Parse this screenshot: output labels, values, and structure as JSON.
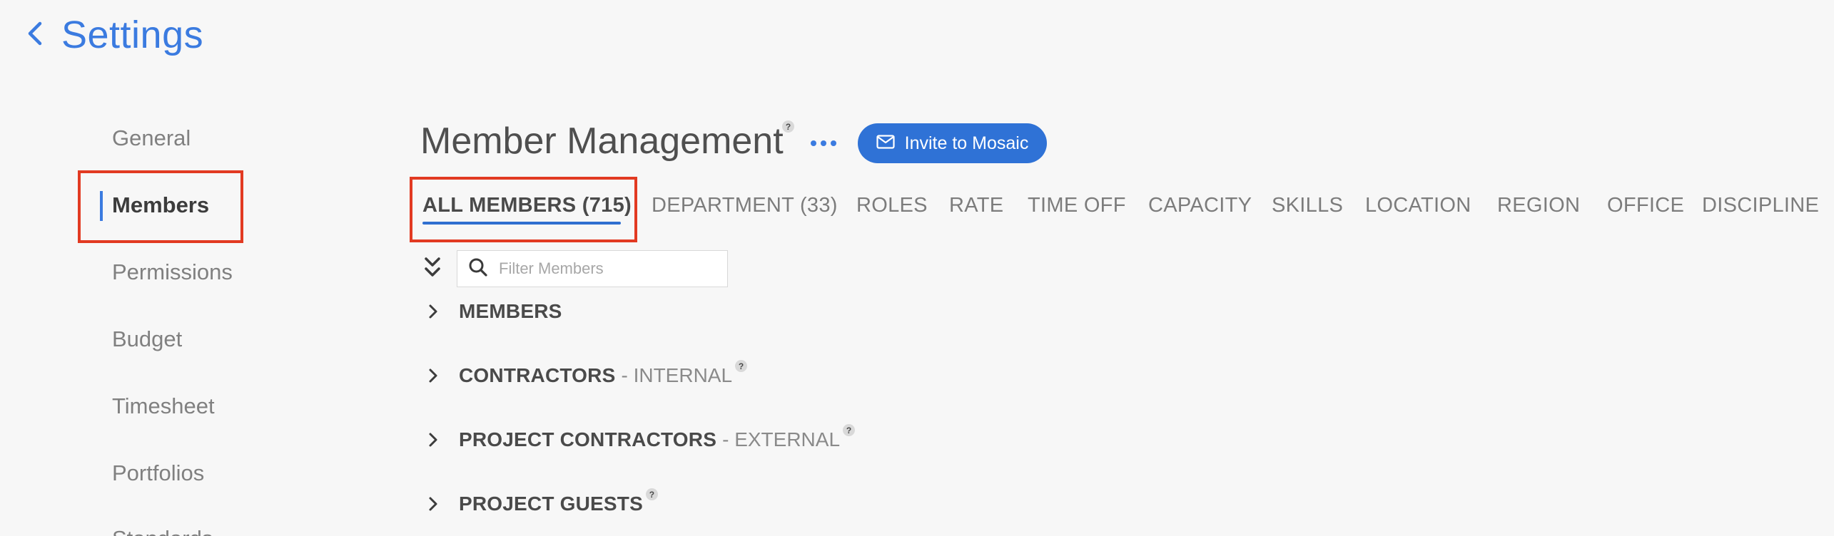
{
  "header": {
    "title": "Settings"
  },
  "sidebar": {
    "items": [
      {
        "label": "General"
      },
      {
        "label": "Members"
      },
      {
        "label": "Permissions"
      },
      {
        "label": "Budget"
      },
      {
        "label": "Timesheet"
      },
      {
        "label": "Portfolios"
      },
      {
        "label": "Standards"
      }
    ],
    "active": "Members"
  },
  "main": {
    "title": "Member Management",
    "help_glyph": "?",
    "invite_label": "Invite to Mosaic",
    "tabs": [
      {
        "label": "ALL MEMBERS (715)"
      },
      {
        "label": "DEPARTMENT (33)"
      },
      {
        "label": "ROLES"
      },
      {
        "label": "RATE"
      },
      {
        "label": "TIME OFF"
      },
      {
        "label": "CAPACITY"
      },
      {
        "label": "SKILLS"
      },
      {
        "label": "LOCATION"
      },
      {
        "label": "REGION"
      },
      {
        "label": "OFFICE"
      },
      {
        "label": "DISCIPLINE"
      }
    ],
    "filter": {
      "placeholder": "Filter Members",
      "value": ""
    },
    "groups": [
      {
        "label": "MEMBERS",
        "sub": ""
      },
      {
        "label": "CONTRACTORS",
        "sub": "- INTERNAL"
      },
      {
        "label": "PROJECT CONTRACTORS",
        "sub": "- EXTERNAL"
      },
      {
        "label": "PROJECT GUESTS",
        "sub": ""
      }
    ]
  },
  "colors": {
    "accent": "#3b7be0",
    "button": "#2f72d6",
    "highlight": "#e23a22",
    "background": "#f7f7f7"
  },
  "icons": [
    "chevron-left-icon",
    "more-icon",
    "mail-icon",
    "double-chevron-down-icon",
    "search-icon",
    "chevron-right-icon",
    "help-icon"
  ]
}
